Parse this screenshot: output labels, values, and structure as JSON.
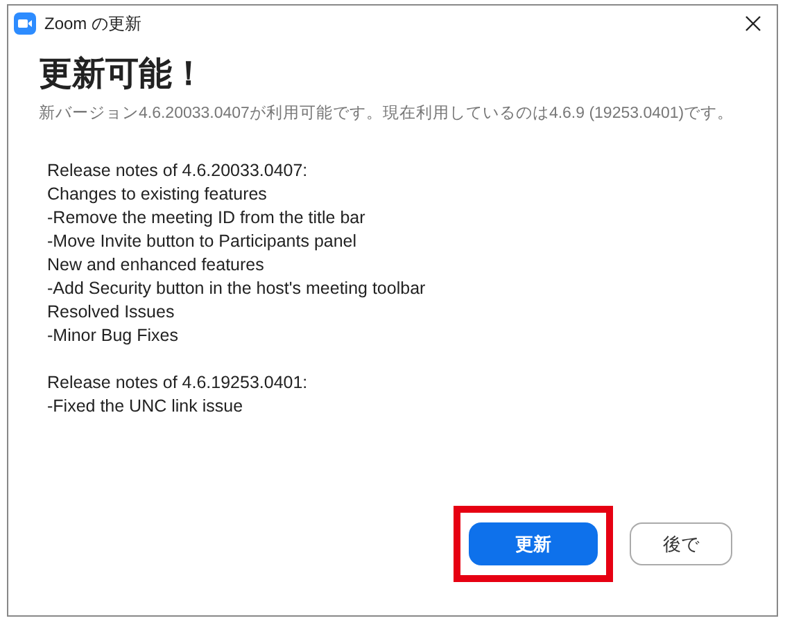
{
  "window": {
    "title": "Zoom の更新"
  },
  "heading": "更新可能！",
  "subtitle": "新バージョン4.6.20033.0407が利用可能です。現在利用しているのは4.6.9 (19253.0401)です。",
  "release_notes": [
    {
      "lines": [
        "Release notes of 4.6.20033.0407:",
        "Changes to existing features",
        "-Remove the meeting ID from the title bar",
        "-Move Invite button to Participants panel",
        "New and enhanced features",
        "-Add Security button in the host's meeting toolbar",
        "Resolved Issues",
        "-Minor Bug Fixes"
      ]
    },
    {
      "lines": [
        "Release notes of 4.6.19253.0401:",
        "-Fixed the UNC link issue"
      ]
    }
  ],
  "buttons": [
    {
      "label": "更新",
      "kind": "primary",
      "highlighted": true
    },
    {
      "label": "後で",
      "kind": "secondary",
      "highlighted": false
    }
  ]
}
